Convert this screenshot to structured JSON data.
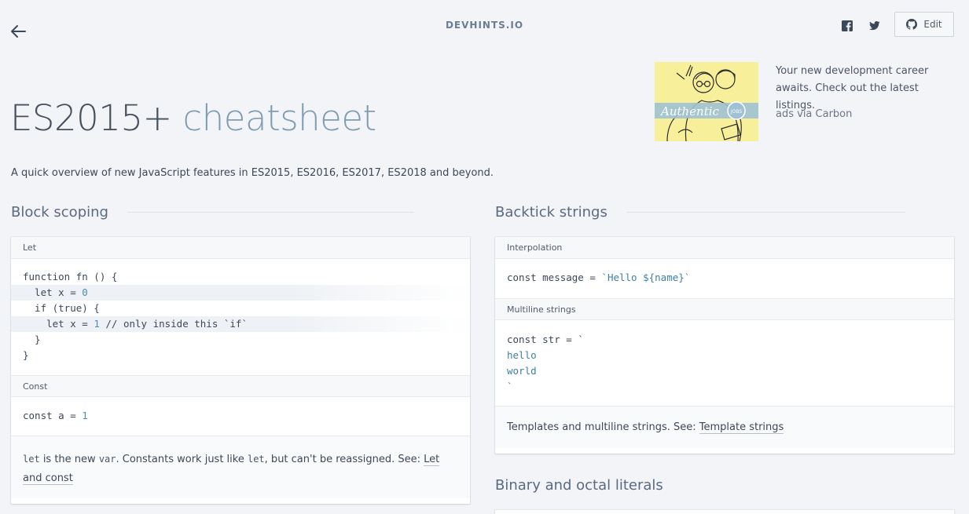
{
  "header": {
    "brand": "DEVHINTS.IO",
    "edit_label": "Edit",
    "icons": [
      "back-arrow-icon",
      "facebook-icon",
      "twitter-icon",
      "github-icon"
    ]
  },
  "hero": {
    "title_main": "ES2015+",
    "title_sub": "cheatsheet",
    "description": "A quick overview of new JavaScript features in ES2015, ES2016, ES2017, ES2018 and beyond."
  },
  "ad": {
    "text": "Your new development career awaits. Check out the latest listings.",
    "via": "ads via Carbon",
    "image_word": "Authentic",
    "image_badge": "JOBS"
  },
  "left": {
    "heading": "Block scoping",
    "let_title": "Let",
    "let_code": [
      "function fn () {",
      "  let x = 0",
      "  if (true) {",
      "    let x = 1 // only inside this `if`",
      "  }",
      "}"
    ],
    "const_title": "Const",
    "const_code": "const a = 1",
    "note_parts": {
      "kw_let": "let",
      "t1": " is the new ",
      "kw_var": "var",
      "t2": ". Constants work just like ",
      "kw_let2": "let",
      "t3": ", but can't be reassigned. See: ",
      "link": "Let and const"
    }
  },
  "right": {
    "heading": "Backtick strings",
    "interp_title": "Interpolation",
    "interp_code_a": "const message = ",
    "interp_code_b": "`Hello ${name}`",
    "multi_title": "Multiline strings",
    "multi_code": [
      "const str = `",
      "hello",
      "world",
      "`"
    ],
    "note_text": "Templates and multiline strings. See: ",
    "note_link": "Template strings",
    "heading2": "Binary and octal literals"
  },
  "colors": {
    "background": "#f2f4f7",
    "accent": "#7e9cb2",
    "number": "#4d8fb0"
  }
}
